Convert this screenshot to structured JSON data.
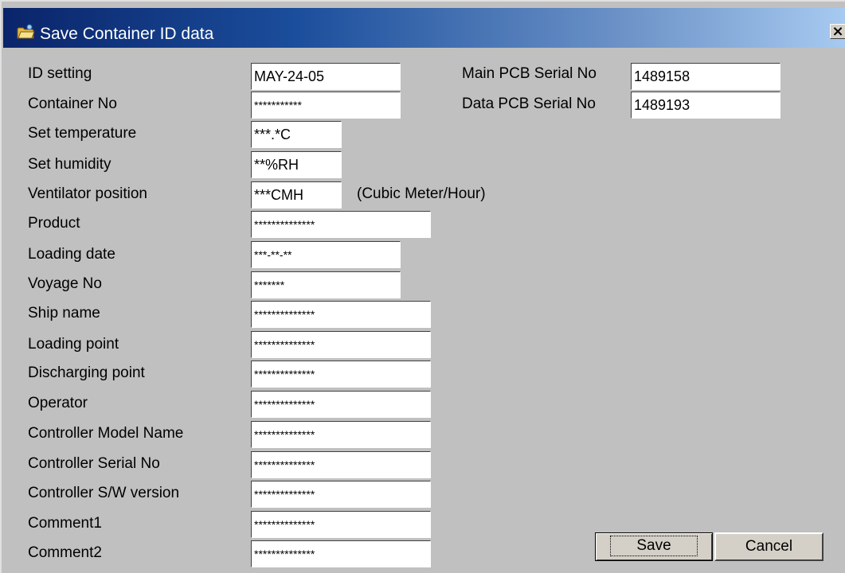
{
  "window": {
    "title": "Save Container ID data",
    "close_label": "×"
  },
  "fields": [
    {
      "label": "ID setting",
      "value": "MAY-24-05"
    },
    {
      "label": "Container No",
      "value": "***********"
    },
    {
      "label": "Set temperature",
      "value": "***.*C"
    },
    {
      "label": "Set humidity",
      "value": "**%RH"
    },
    {
      "label": "Ventilator position",
      "value": "***CMH",
      "unit_note": "(Cubic Meter/Hour)"
    },
    {
      "label": "Product",
      "value": "**************"
    },
    {
      "label": "Loading date",
      "value": "***-**-**"
    },
    {
      "label": "Voyage No",
      "value": "*******"
    },
    {
      "label": "Ship name",
      "value": "**************"
    },
    {
      "label": "Loading point",
      "value": "**************"
    },
    {
      "label": "Discharging point",
      "value": "**************"
    },
    {
      "label": "Operator",
      "value": "**************"
    },
    {
      "label": "Controller Model Name",
      "value": "**************"
    },
    {
      "label": "Controller Serial No",
      "value": "**************"
    },
    {
      "label": "Controller S/W version",
      "value": "**************"
    },
    {
      "label": "Comment1",
      "value": "**************"
    },
    {
      "label": "Comment2",
      "value": "**************"
    }
  ],
  "serials": {
    "main_pcb_label": "Main PCB Serial No",
    "main_pcb_value": "1489158",
    "data_pcb_label": "Data PCB Serial No",
    "data_pcb_value": "1489193"
  },
  "buttons": {
    "save_label": "Save",
    "cancel_label": "Cancel"
  }
}
